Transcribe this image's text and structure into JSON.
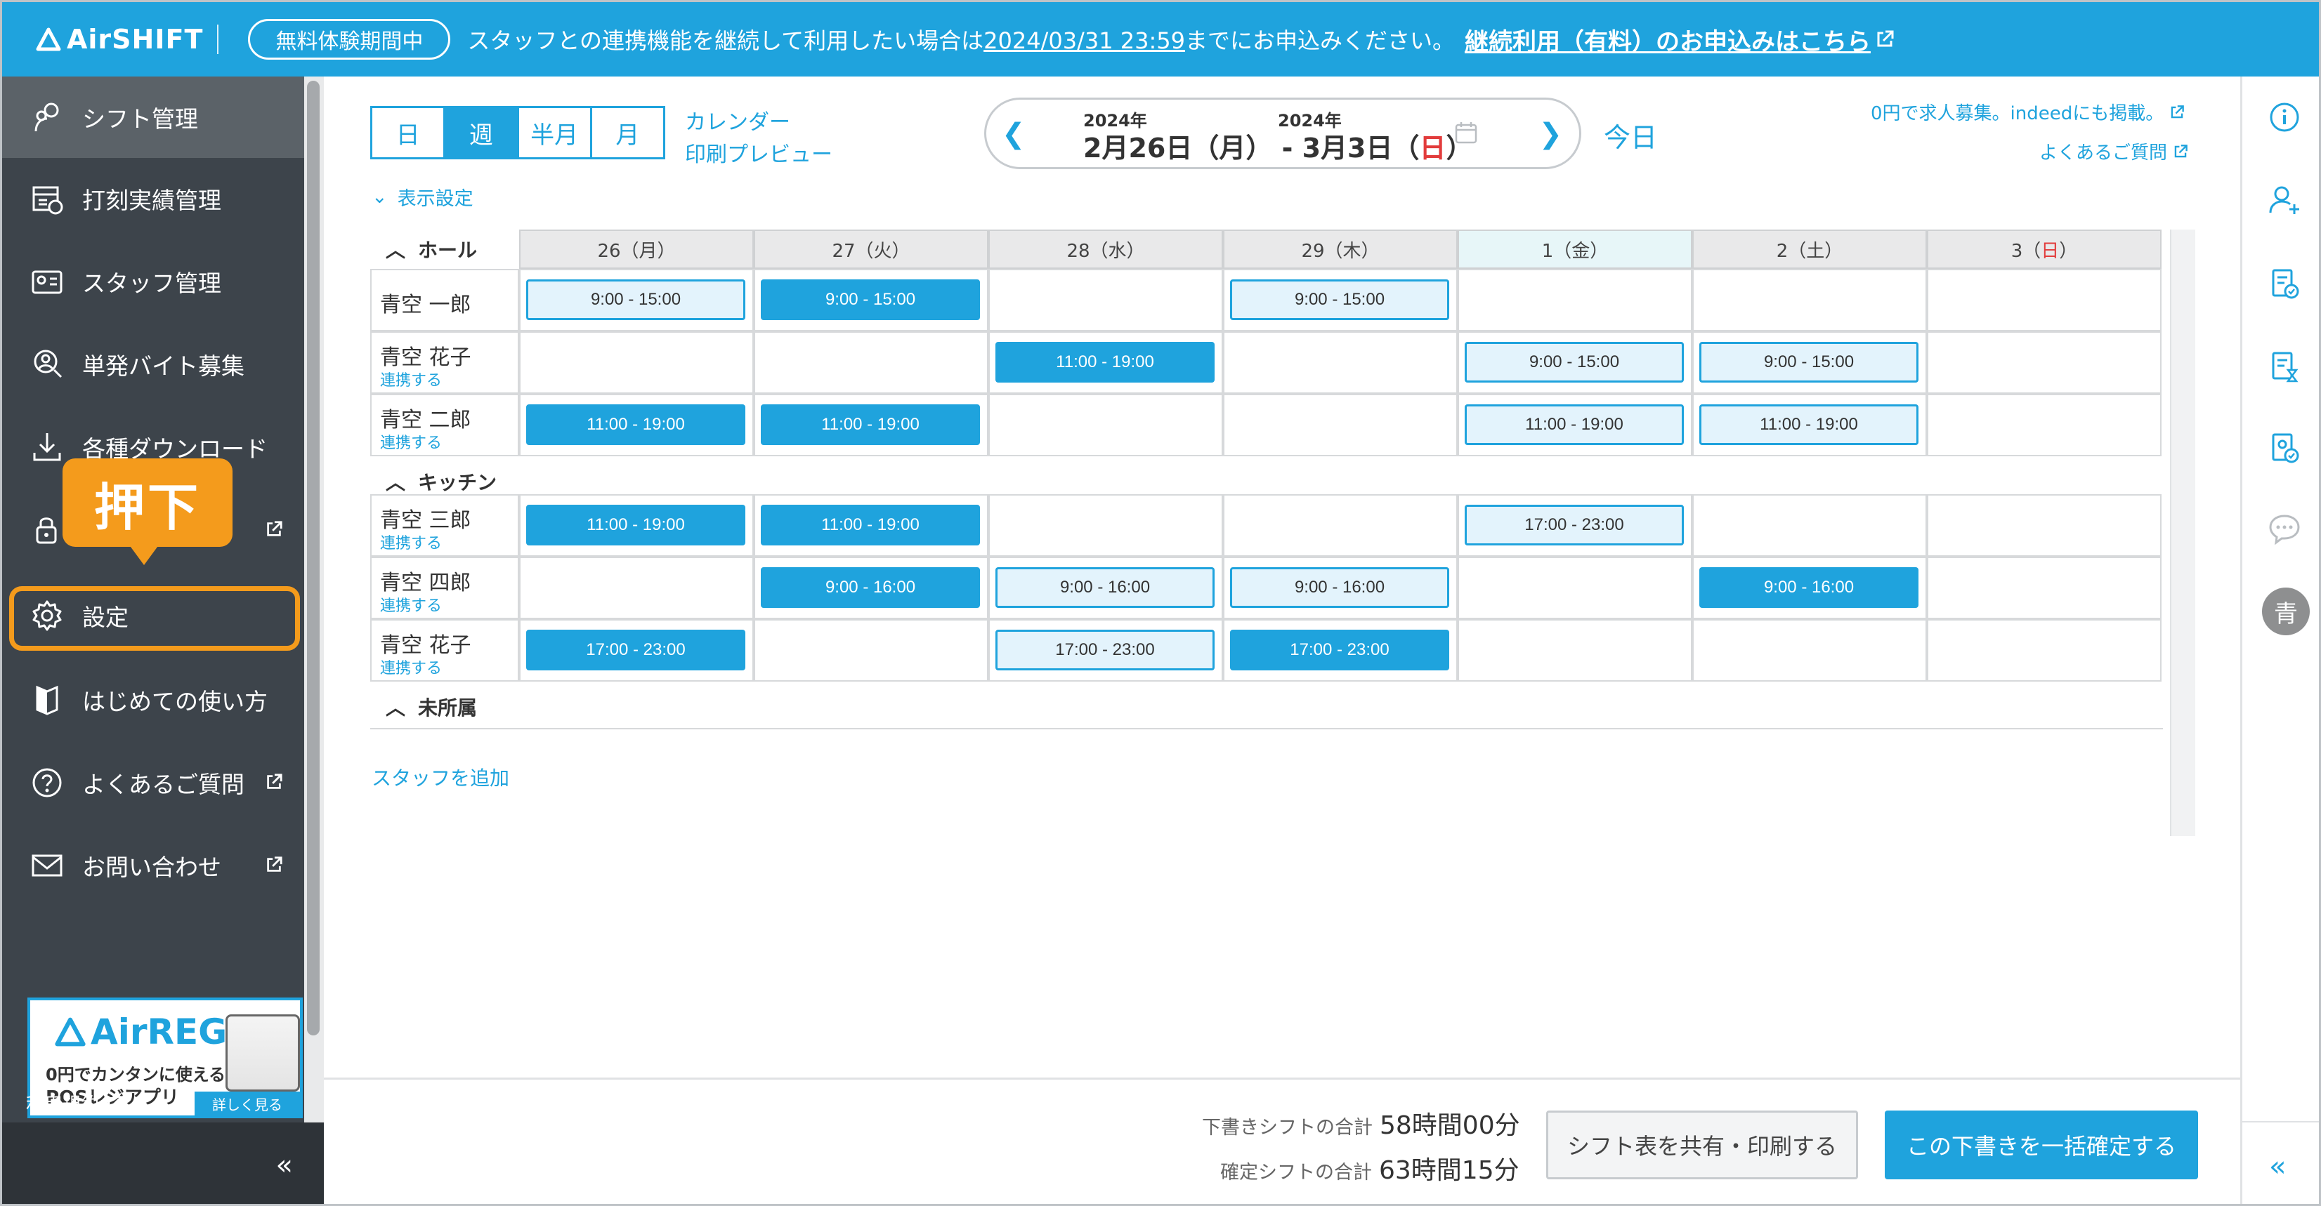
{
  "app": {
    "logo_text": "AirSHIFT"
  },
  "banner": {
    "trial_badge": "無料体験期間中",
    "message_before": "スタッフとの連携機能を継続して利用したい場合は",
    "deadline": "2024/03/31 23:59",
    "message_after": "までにお申込みください。",
    "link_label": "継続利用（有料）のお申込みはこちら"
  },
  "sidebar": {
    "items": [
      {
        "label": "シフト管理",
        "icon": "shift-icon"
      },
      {
        "label": "打刻実績管理",
        "icon": "timecard-icon"
      },
      {
        "label": "スタッフ管理",
        "icon": "staff-card-icon"
      },
      {
        "label": "単発バイト募集",
        "icon": "recruit-icon"
      },
      {
        "label": "各種ダウンロード",
        "icon": "download-icon"
      },
      {
        "label": "",
        "icon": "lock-icon"
      },
      {
        "label": "設定",
        "icon": "gear-icon"
      },
      {
        "label": "はじめての使い方",
        "icon": "guide-icon"
      },
      {
        "label": "よくあるご質問",
        "icon": "question-icon"
      },
      {
        "label": "お問い合わせ",
        "icon": "mail-icon"
      }
    ],
    "ad": {
      "title": "AirREGI",
      "line1": "0円でカンタンに使える",
      "line2": "POSレジアプリ",
      "button": "詳しく見る"
    },
    "terms": "利用規約",
    "collapse": "«"
  },
  "callout": {
    "text": "押下"
  },
  "toolbar": {
    "views": [
      "日",
      "週",
      "半月",
      "月"
    ],
    "active_view": "週",
    "calendar_link": "カレンダー",
    "print_preview": "印刷プレビュー",
    "year_start": "2024年",
    "year_end": "2024年",
    "range_start": "2月26日（月）",
    "range_sep": "-",
    "range_end_pre": "3月3日（",
    "range_end_day": "日",
    "range_end_post": "）",
    "today": "今日",
    "display_settings": "表示設定",
    "recruit_link": "0円で求人募集。indeedにも掲載。",
    "faq_link": "よくあるご質問"
  },
  "grid": {
    "days": [
      "26（月）",
      "27（火）",
      "28（水）",
      "29（木）",
      "1（金）",
      "2（土）",
      "3（日）"
    ],
    "sync_label": "連携する",
    "groups": [
      {
        "name": "ホール",
        "rows": [
          {
            "name": "青空 一郎",
            "sync": false,
            "shifts": [
              [
                "9:00 - 15:00",
                "draft"
              ],
              [
                "9:00 - 15:00",
                "done"
              ],
              null,
              [
                "9:00 - 15:00",
                "draft"
              ],
              null,
              null,
              null
            ]
          },
          {
            "name": "青空 花子",
            "sync": true,
            "shifts": [
              null,
              null,
              [
                "11:00 - 19:00",
                "done"
              ],
              null,
              [
                "9:00 - 15:00",
                "draft"
              ],
              [
                "9:00 - 15:00",
                "draft"
              ],
              null
            ]
          },
          {
            "name": "青空 二郎",
            "sync": true,
            "shifts": [
              [
                "11:00 - 19:00",
                "done"
              ],
              [
                "11:00 - 19:00",
                "done"
              ],
              null,
              null,
              [
                "11:00 - 19:00",
                "draft"
              ],
              [
                "11:00 - 19:00",
                "draft"
              ],
              null
            ]
          }
        ]
      },
      {
        "name": "キッチン",
        "rows": [
          {
            "name": "青空 三郎",
            "sync": true,
            "shifts": [
              [
                "11:00 - 19:00",
                "done"
              ],
              [
                "11:00 - 19:00",
                "done"
              ],
              null,
              null,
              [
                "17:00 - 23:00",
                "draft"
              ],
              null,
              null
            ]
          },
          {
            "name": "青空 四郎",
            "sync": true,
            "shifts": [
              null,
              [
                "9:00 - 16:00",
                "done"
              ],
              [
                "9:00 - 16:00",
                "draft"
              ],
              [
                "9:00 - 16:00",
                "draft"
              ],
              null,
              [
                "9:00 - 16:00",
                "done"
              ],
              null
            ]
          },
          {
            "name": "青空 花子",
            "sync": true,
            "shifts": [
              [
                "17:00 - 23:00",
                "done"
              ],
              null,
              [
                "17:00 - 23:00",
                "draft"
              ],
              [
                "17:00 - 23:00",
                "done"
              ],
              null,
              null,
              null
            ]
          }
        ]
      },
      {
        "name": "未所属",
        "rows": []
      }
    ],
    "add_staff": "スタッフを追加"
  },
  "footer": {
    "draft_label": "下書きシフトの合計",
    "draft_value": "58時間00分",
    "confirmed_label": "確定シフトの合計",
    "confirmed_value": "63時間15分",
    "share_button": "シフト表を共有・印刷する",
    "confirm_button": "この下書きを一括確定する"
  },
  "right_rail": {
    "avatar": "青",
    "collapse": "«"
  },
  "colors": {
    "brand": "#1fa3dd",
    "sidebar": "#3d444b",
    "callout": "#f49b1c",
    "sunday": "#e23c3c"
  }
}
